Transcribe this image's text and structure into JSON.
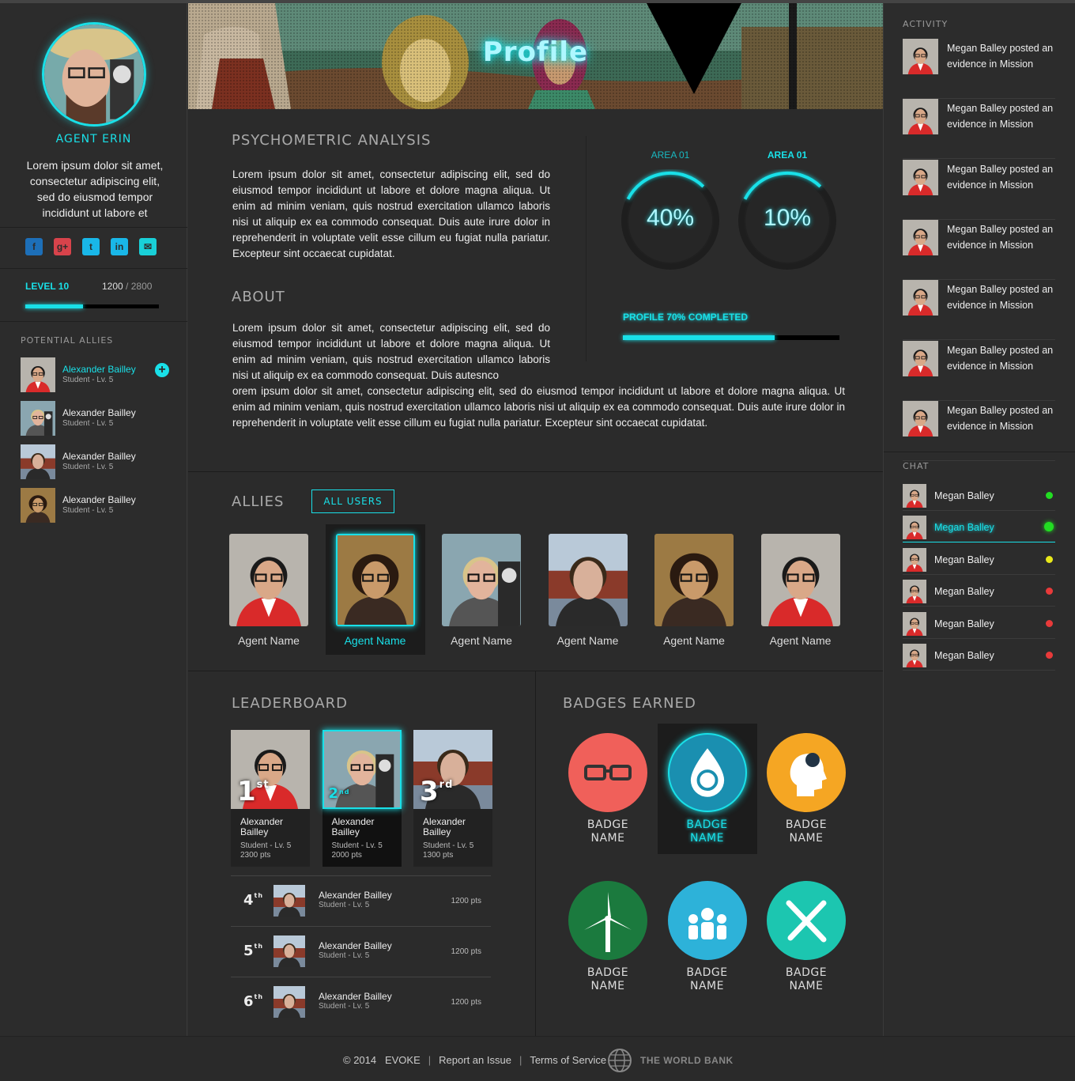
{
  "profile": {
    "name": "AGENT ERIN",
    "bio": "Lorem ipsum dolor sit amet, consectetur adipiscing elit, sed do eiusmod tempor incididunt ut labore et",
    "level_label": "LEVEL 10",
    "xp_current": "1200",
    "xp_total": "/ 2800",
    "level_progress": 0.43
  },
  "socials": [
    {
      "icon": "facebook-icon",
      "glyph": "f",
      "color": "#1d6fb8"
    },
    {
      "icon": "google-plus-icon",
      "glyph": "g+",
      "color": "#d8434b"
    },
    {
      "icon": "twitter-icon",
      "glyph": "t",
      "color": "#19b7e8"
    },
    {
      "icon": "linkedin-icon",
      "glyph": "in",
      "color": "#19b7e8"
    },
    {
      "icon": "email-icon",
      "glyph": "✉",
      "color": "#19d0d8"
    }
  ],
  "potential_allies": {
    "title": "POTENTIAL ALLIES",
    "items": [
      {
        "name": "Alexander Bailley",
        "sub": "Student - Lv. 5",
        "highlight": true
      },
      {
        "name": "Alexander Bailley",
        "sub": "Student - Lv. 5"
      },
      {
        "name": "Alexander Bailley",
        "sub": "Student - Lv. 5"
      },
      {
        "name": "Alexander Bailley",
        "sub": "Student - Lv. 5"
      }
    ]
  },
  "banner": {
    "title": "Profile"
  },
  "psychometric": {
    "title": "PSYCHOMETRIC ANALYSIS",
    "text": "Lorem ipsum dolor sit amet, consectetur adipiscing elit, sed do eiusmod tempor incididunt ut labore et dolore magna aliqua. Ut enim ad minim veniam, quis nostrud exercitation ullamco laboris nisi ut aliquip ex ea commodo consequat. Duis aute irure dolor in reprehenderit in voluptate velit esse cillum eu fugiat nulla pariatur. Excepteur sint occaecat cupidatat."
  },
  "about": {
    "title": "ABOUT",
    "text_narrow": "Lorem ipsum dolor sit amet, consectetur adipiscing elit, sed do eiusmod tempor incididunt ut labore et dolore magna aliqua. Ut enim ad minim veniam, quis nostrud exercitation ullamco laboris nisi ut aliquip ex ea commodo consequat. Duis autesnco",
    "text_wide": "orem ipsum dolor sit amet, consectetur adipiscing elit, sed do eiusmod tempor incididunt ut labore et dolore magna aliqua. Ut enim ad minim veniam, quis nostrud exercitation ullamco laboris nisi ut aliquip ex ea commodo consequat. Duis aute irure dolor in reprehenderit in voluptate velit esse cillum eu fugiat nulla pariatur. Excepteur sint occaecat cupidatat."
  },
  "areas": [
    {
      "label": "AREA 01",
      "value": "40%",
      "fraction": 0.4,
      "bold": false
    },
    {
      "label": "AREA 01",
      "value": "10%",
      "fraction": 0.1,
      "bold": true
    }
  ],
  "profile_completion": {
    "label": "PROFILE 70% COMPLETED",
    "fraction": 0.7
  },
  "allies": {
    "title": "ALLIES",
    "button": "ALL USERS",
    "items": [
      {
        "name": "Agent Name"
      },
      {
        "name": "Agent Name",
        "selected": true
      },
      {
        "name": "Agent Name"
      },
      {
        "name": "Agent Name"
      },
      {
        "name": "Agent Name"
      },
      {
        "name": "Agent Name"
      }
    ]
  },
  "leaderboard": {
    "title": "LEADERBOARD",
    "top": [
      {
        "rank": "1",
        "suffix": "st",
        "name": "Alexander Bailley",
        "sub": "Student - Lv. 5",
        "pts": "2300 pts"
      },
      {
        "rank": "2",
        "suffix": "nd",
        "name": "Alexander Bailley",
        "sub": "Student - Lv. 5",
        "pts": "2000 pts",
        "selected": true
      },
      {
        "rank": "3",
        "suffix": "rd",
        "name": "Alexander Bailley",
        "sub": "Student - Lv. 5",
        "pts": "1300 pts"
      }
    ],
    "rows": [
      {
        "rank": "4",
        "suffix": "th",
        "name": "Alexander Bailley",
        "sub": "Student - Lv. 5",
        "pts": "1200 pts"
      },
      {
        "rank": "5",
        "suffix": "th",
        "name": "Alexander Bailley",
        "sub": "Student - Lv. 5",
        "pts": "1200 pts"
      },
      {
        "rank": "6",
        "suffix": "th",
        "name": "Alexander Bailley",
        "sub": "Student - Lv. 5",
        "pts": "1200 pts"
      }
    ]
  },
  "badges": {
    "title": "BADGES EARNED",
    "items": [
      {
        "line1": "BADGE",
        "line2": "NAME",
        "icon": "glasses-icon",
        "color": "#f0605a"
      },
      {
        "line1": "BADGE",
        "line2": "NAME",
        "icon": "water-drop-icon",
        "color": "#1a8fb0",
        "selected": true
      },
      {
        "line1": "BADGE",
        "line2": "NAME",
        "icon": "head-idea-icon",
        "color": "#f5a623"
      },
      {
        "line1": "BADGE",
        "line2": "NAME",
        "icon": "wind-turbine-icon",
        "color": "#1b7a3e"
      },
      {
        "line1": "BADGE",
        "line2": "NAME",
        "icon": "community-icon",
        "color": "#2db2d9"
      },
      {
        "line1": "BADGE",
        "line2": "NAME",
        "icon": "fork-knife-icon",
        "color": "#1cc6b0"
      }
    ]
  },
  "activity": {
    "title": "ACTIVITY",
    "items": [
      {
        "text": "Megan Balley posted an evidence in Mission"
      },
      {
        "text": "Megan Balley posted an evidence in Mission"
      },
      {
        "text": "Megan Balley posted an evidence in Mission"
      },
      {
        "text": "Megan Balley posted an evidence in Mission"
      },
      {
        "text": "Megan Balley posted an evidence in Mission"
      },
      {
        "text": "Megan Balley posted an evidence in Mission"
      },
      {
        "text": "Megan Balley posted an evidence in Mission"
      }
    ]
  },
  "chat": {
    "title": "CHAT",
    "items": [
      {
        "name": "Megan Balley",
        "status_color": "#22dd22"
      },
      {
        "name": "Megan Balley",
        "status_color": "#22dd22",
        "selected": true
      },
      {
        "name": "Megan Balley",
        "status_color": "#e8e81a"
      },
      {
        "name": "Megan Balley",
        "status_color": "#e83a3a"
      },
      {
        "name": "Megan Balley",
        "status_color": "#e83a3a"
      },
      {
        "name": "Megan Balley",
        "status_color": "#e83a3a"
      }
    ]
  },
  "footer": {
    "copyright": "© 2014",
    "brand": "EVOKE",
    "report": "Report an Issue",
    "terms": "Terms of Service",
    "partner": "THE WORLD BANK"
  },
  "colors": {
    "accent": "#19e0e8"
  }
}
